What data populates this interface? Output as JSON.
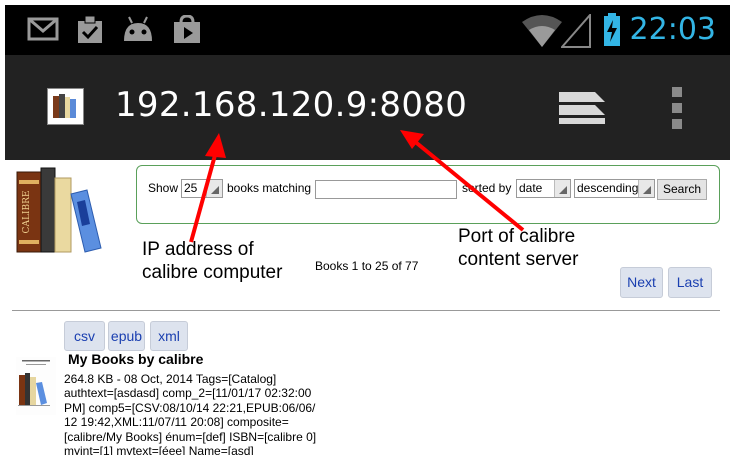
{
  "status_bar": {
    "time": "22:03",
    "notification_icons": [
      "gmail-icon",
      "clipboard-check-icon",
      "android-icon",
      "play-store-icon"
    ],
    "system_icons": [
      "wifi-icon",
      "signal-icon",
      "battery-charging-icon"
    ],
    "time_color": "#33b5e5"
  },
  "app_bar": {
    "url": "192.168.120.9:8080",
    "app_icon": "calibre-icon",
    "tabs_icon": "tabs-icon",
    "menu_icon": "overflow-menu-icon"
  },
  "search": {
    "show_label": "Show",
    "show_value": "25",
    "matching_label": "books matching",
    "query": "",
    "sorted_label": "sorted by",
    "sort_field": "date",
    "sort_order": "descending",
    "button_label": "Search"
  },
  "annotations": {
    "ip_line1": "IP address of",
    "ip_line2": "calibre computer",
    "port_line1": "Port of calibre",
    "port_line2": "content server",
    "arrow_color": "#ff0000"
  },
  "pagination": {
    "range_text": "Books 1 to 25 of 77",
    "next_label": "Next",
    "last_label": "Last"
  },
  "book": {
    "formats": [
      "csv",
      "epub",
      "xml"
    ],
    "title": "My Books by calibre",
    "details": [
      "264.8 KB - 08 Oct, 2014 Tags=[Catalog]",
      "authtext=[asdasd] comp_2=[11/01/17 02:32:00",
      "PM] comp5=[CSV:08/10/14 22:21,EPUB:06/06/",
      "12 19:42,XML:11/07/11 20:08] composite=",
      "[calibre/My Books] énum=[def] ISBN=[calibre 0]",
      "myint=[1] mytext=[éee] Name=[asd]"
    ]
  }
}
